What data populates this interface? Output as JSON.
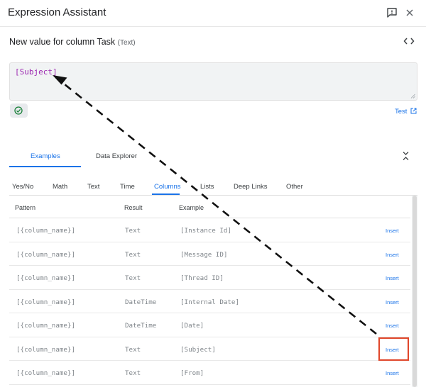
{
  "window": {
    "title": "Expression Assistant"
  },
  "header": {
    "subtitle": "New value for column Task",
    "subtitle_type": "(Text)"
  },
  "editor": {
    "expression": "[Subject]"
  },
  "test_link": {
    "label": "Test"
  },
  "main_tabs": [
    {
      "label": "Examples",
      "active": true
    },
    {
      "label": "Data Explorer",
      "active": false
    }
  ],
  "sub_tabs": [
    {
      "label": "Yes/No",
      "active": false
    },
    {
      "label": "Math",
      "active": false
    },
    {
      "label": "Text",
      "active": false
    },
    {
      "label": "Time",
      "active": false
    },
    {
      "label": "Columns",
      "active": true
    },
    {
      "label": "Lists",
      "active": false
    },
    {
      "label": "Deep Links",
      "active": false
    },
    {
      "label": "Other",
      "active": false
    }
  ],
  "table": {
    "headers": {
      "pattern": "Pattern",
      "result": "Result",
      "example": "Example"
    },
    "rows": [
      {
        "pattern": "[{column_name}]",
        "result": "Text",
        "example": "[Instance Id]",
        "action": "Insert"
      },
      {
        "pattern": "[{column_name}]",
        "result": "Text",
        "example": "[Message ID]",
        "action": "Insert"
      },
      {
        "pattern": "[{column_name}]",
        "result": "Text",
        "example": "[Thread ID]",
        "action": "Insert"
      },
      {
        "pattern": "[{column_name}]",
        "result": "DateTime",
        "example": "[Internal Date]",
        "action": "Insert"
      },
      {
        "pattern": "[{column_name}]",
        "result": "DateTime",
        "example": "[Date]",
        "action": "Insert"
      },
      {
        "pattern": "[{column_name}]",
        "result": "Text",
        "example": "[Subject]",
        "action": "Insert"
      },
      {
        "pattern": "[{column_name}]",
        "result": "Text",
        "example": "[From]",
        "action": "Insert"
      }
    ]
  },
  "colors": {
    "accent": "#1a73e8",
    "expression": "#9c27b0",
    "highlight": "#e0462a",
    "valid": "#188038"
  },
  "icons": {
    "feedback": "feedback-icon",
    "close": "close-icon",
    "code": "code-icon",
    "valid": "check-circle-icon",
    "external": "open-in-new-icon",
    "collapse": "collapse-icon"
  }
}
